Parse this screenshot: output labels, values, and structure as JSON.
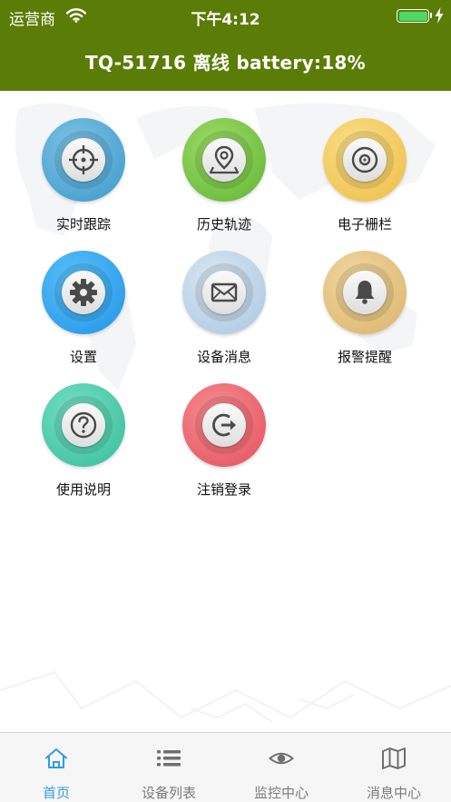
{
  "status_bar": {
    "carrier": "运营商",
    "time": "下午4:12"
  },
  "header": {
    "title": "TQ-51716 离线 battery:18%"
  },
  "colors": {
    "header_bg": "#5b7c06",
    "active_tab": "#2d9de2",
    "inactive_tab": "#7b7b7b",
    "battery": "#4cd964"
  },
  "grid": [
    {
      "label": "实时跟踪",
      "icon": "crosshair-icon"
    },
    {
      "label": "历史轨迹",
      "icon": "map-pin-icon"
    },
    {
      "label": "电子栅栏",
      "icon": "disc-icon"
    },
    {
      "label": "设置",
      "icon": "gear-icon"
    },
    {
      "label": "设备消息",
      "icon": "envelope-icon"
    },
    {
      "label": "报警提醒",
      "icon": "bell-icon"
    },
    {
      "label": "使用说明",
      "icon": "question-icon"
    },
    {
      "label": "注销登录",
      "icon": "logout-icon"
    }
  ],
  "tabs": [
    {
      "label": "首页",
      "icon": "home-icon",
      "active": true
    },
    {
      "label": "设备列表",
      "icon": "list-icon",
      "active": false
    },
    {
      "label": "监控中心",
      "icon": "eye-icon",
      "active": false
    },
    {
      "label": "消息中心",
      "icon": "map-icon",
      "active": false
    }
  ]
}
